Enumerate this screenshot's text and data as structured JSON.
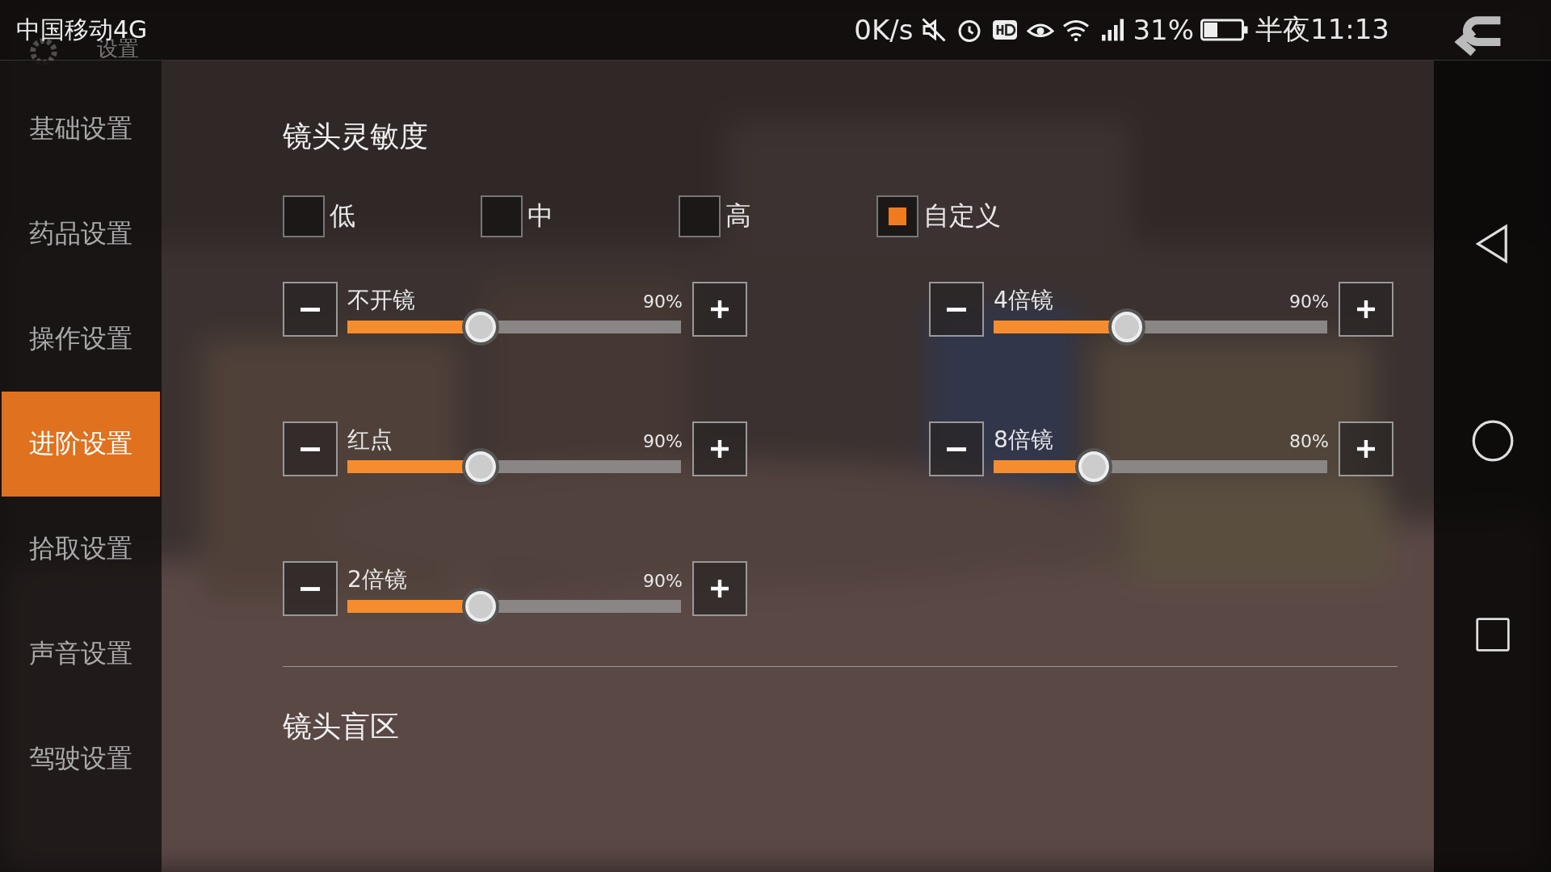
{
  "status_bar": {
    "carrier": "中国移动4G",
    "speed": "0K/s",
    "battery": "31%",
    "time": "半夜11:13"
  },
  "header": {
    "title": "设置"
  },
  "sidebar": {
    "items": [
      {
        "label": "基础设置",
        "selected": false
      },
      {
        "label": "药品设置",
        "selected": false
      },
      {
        "label": "操作设置",
        "selected": false
      },
      {
        "label": "进阶设置",
        "selected": true
      },
      {
        "label": "拾取设置",
        "selected": false
      },
      {
        "label": "声音设置",
        "selected": false
      },
      {
        "label": "驾驶设置",
        "selected": false
      }
    ]
  },
  "sensitivity": {
    "title": "镜头灵敏度",
    "presets": [
      {
        "label": "低",
        "selected": false
      },
      {
        "label": "中",
        "selected": false
      },
      {
        "label": "高",
        "selected": false
      },
      {
        "label": "自定义",
        "selected": true
      }
    ],
    "sliders": [
      {
        "label": "不开镜",
        "reading": "90%",
        "level": 0.4
      },
      {
        "label": "4倍镜",
        "reading": "90%",
        "level": 0.4
      },
      {
        "label": "红点",
        "reading": "90%",
        "level": 0.4
      },
      {
        "label": "8倍镜",
        "reading": "80%",
        "level": 0.3
      },
      {
        "label": "2倍镜",
        "reading": "90%",
        "level": 0.4
      }
    ]
  },
  "blind_zone": {
    "title": "镜头盲区"
  }
}
